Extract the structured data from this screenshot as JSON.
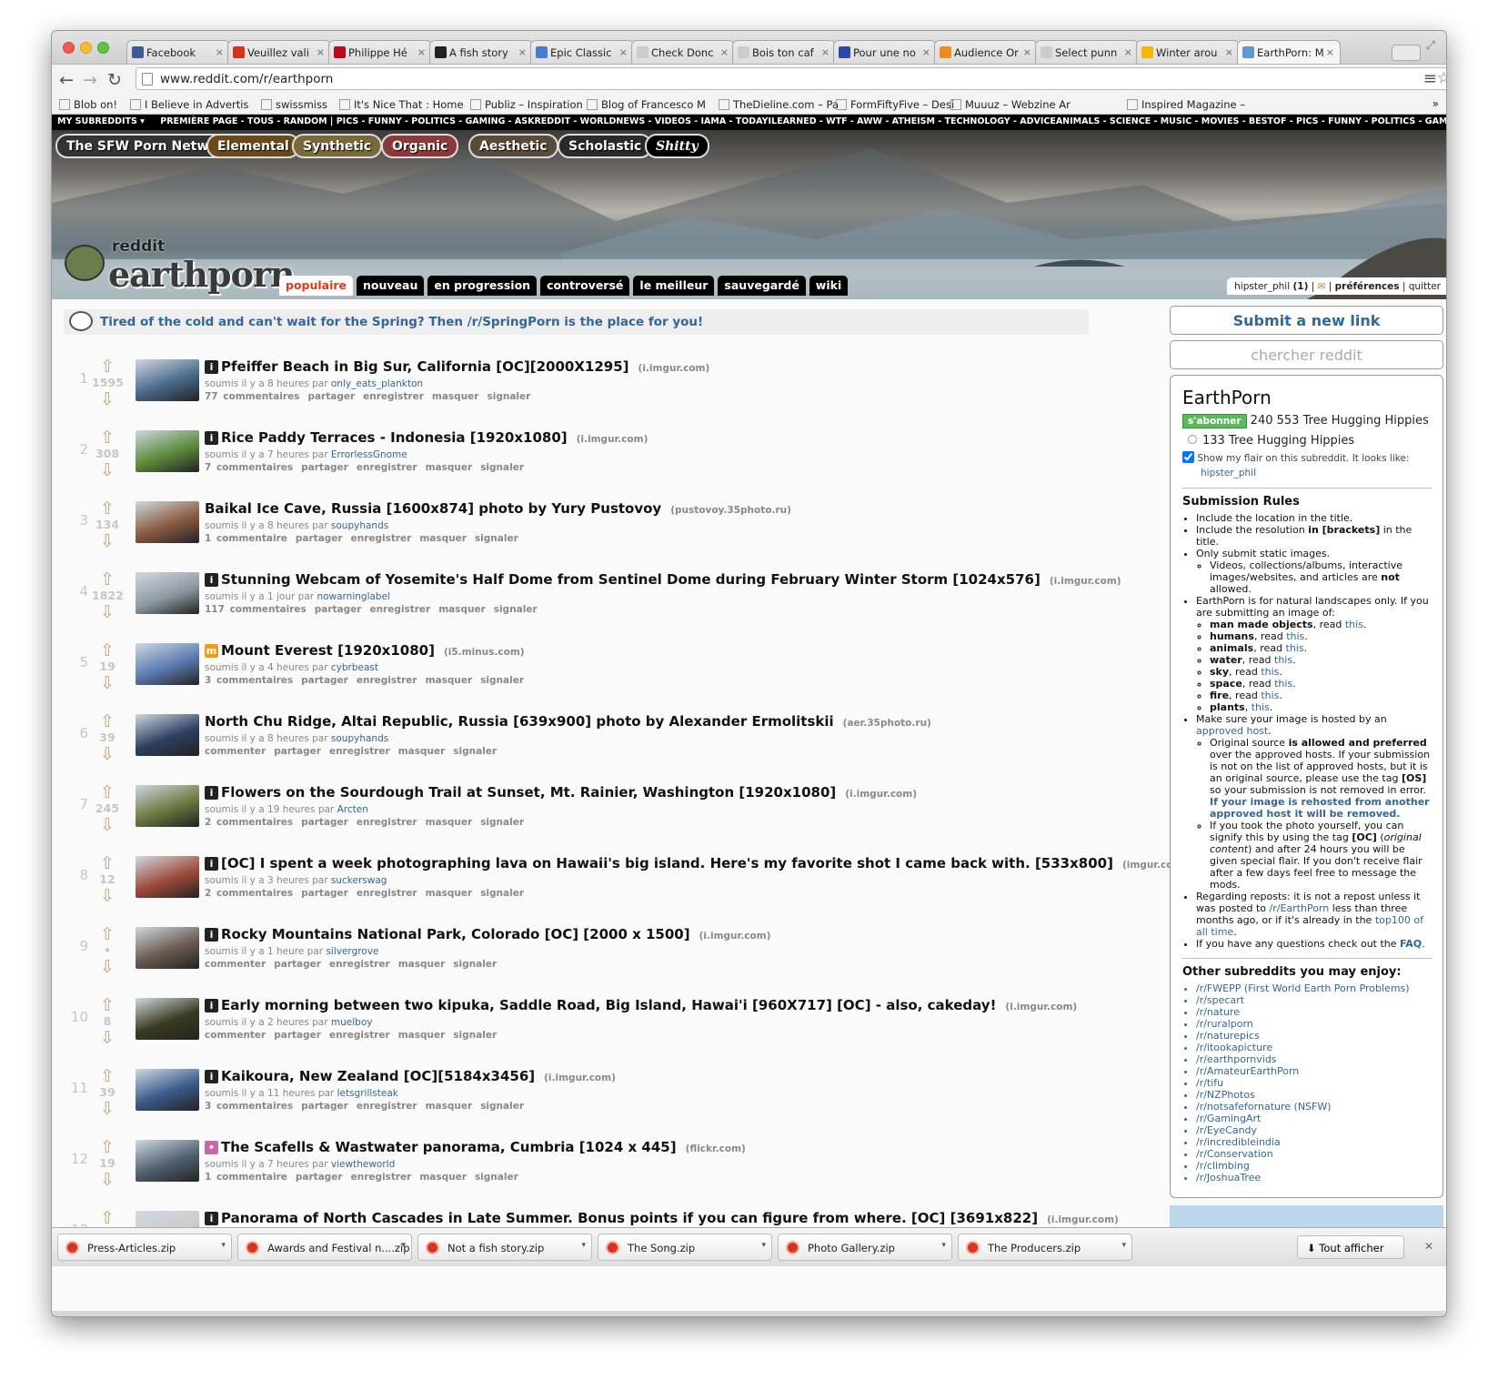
{
  "browser": {
    "tabs": [
      {
        "label": "Facebook",
        "color": "#3b5998"
      },
      {
        "label": "Veuillez vali",
        "color": "#d93025"
      },
      {
        "label": "Philippe Hé",
        "color": "#bd081c"
      },
      {
        "label": "A fish story",
        "color": "#222222"
      },
      {
        "label": "Epic Classic",
        "color": "#4a7bd3"
      },
      {
        "label": "Check Donc",
        "color": "#cccccc"
      },
      {
        "label": "Bois ton caf",
        "color": "#cccccc"
      },
      {
        "label": "Pour une no",
        "color": "#2a4aa8"
      },
      {
        "label": "Audience Or",
        "color": "#f08a24"
      },
      {
        "label": "Select punn",
        "color": "#cccccc"
      },
      {
        "label": "Winter arou",
        "color": "#f5b800"
      },
      {
        "label": "EarthPorn: M",
        "color": "#5f99cf"
      }
    ],
    "url": "www.reddit.com/r/earthporn",
    "bookmarks": [
      {
        "label": "Blob on!"
      },
      {
        "label": "I Believe in Advertis"
      },
      {
        "label": "swissmiss"
      },
      {
        "label": "It's Nice That : Home"
      },
      {
        "label": "Publiz – Inspiration"
      },
      {
        "label": "Blog of Francesco M"
      },
      {
        "label": "TheDieline.com – Pa"
      },
      {
        "label": "FormFiftyFive – Desi"
      },
      {
        "label": "Muuuz – Webzine Ar"
      },
      {
        "label": "Inspired Magazine –"
      }
    ]
  },
  "reddit": {
    "my_subreddits": "MY SUBREDDITS",
    "srbar": "PREMIÈRE PAGE - TOUS - RANDOM  |  PICS - FUNNY - POLITICS - GAMING - ASKREDDIT - WORLDNEWS - VIDEOS - IAMA - TODAYILEARNED - WTF - AWW - ATHEISM - TECHNOLOGY - ADVICEANIMALS - SCIENCE - MUSIC - MOVIES - BESTOF  -  PICS - FUNNY - POLITICS - GAMING - ASKREDDIT - WORLDNEWS",
    "network": [
      "The SFW Porn Network",
      "Elemental",
      "Synthetic",
      "Organic",
      "Aesthetic",
      "Scholastic",
      "Shitty"
    ],
    "logo_top": "reddit",
    "logo_main": "earthporn",
    "sort_tabs": [
      "populaire",
      "nouveau",
      "en progression",
      "controversé",
      "le meilleur",
      "sauvegardé",
      "wiki"
    ],
    "user": "hipster_phil",
    "karma": "(1)",
    "prefs": "préférences",
    "logout": "quitter",
    "announce": "Tired of the cold and can't wait for the Spring? Then /r/SpringPorn is the place for you!",
    "posts": [
      {
        "rank": "1",
        "score": "1595",
        "title": "Pfeiffer Beach in Big Sur, California [OC][2000X1295]",
        "domain": "(i.imgur.com)",
        "time": "soumis il y a 8 heures par",
        "author": "only_eats_plankton",
        "comments": "77 commentaires",
        "thumb": "#4a6a8a"
      },
      {
        "rank": "2",
        "score": "308",
        "title": "Rice Paddy Terraces - Indonesia [1920x1080]",
        "domain": "(i.imgur.com)",
        "time": "soumis il y a 7 heures par",
        "author": "ErrorlessGnome",
        "comments": "7 commentaires",
        "thumb": "#5d8a3c"
      },
      {
        "rank": "3",
        "score": "134",
        "title": "Baikal Ice Cave, Russia [1600x874] photo by Yury Pustovoy",
        "domain": "(pustovoy.35photo.ru)",
        "time": "soumis il y a 8 heures par",
        "author": "soupyhands",
        "comments": "1 commentaire",
        "thumb": "#8a5a40"
      },
      {
        "rank": "4",
        "score": "1822",
        "title": "Stunning Webcam of Yosemite's Half Dome from Sentinel Dome during February Winter Storm [1024x576]",
        "domain": "(i.imgur.com)",
        "time": "soumis il y a 1 jour par",
        "author": "nowarninglabel",
        "comments": "117 commentaires",
        "thumb": "#8e9aa2"
      },
      {
        "rank": "5",
        "score": "19",
        "title": "Mount Everest [1920x1080]",
        "domain": "(i5.minus.com)",
        "time": "soumis il y a 4 heures par",
        "author": "cybrbeast",
        "comments": "3 commentaires",
        "thumb": "#5a7ab0"
      },
      {
        "rank": "6",
        "score": "39",
        "title": "North Chu Ridge, Altai Republic, Russia [639x900] photo by Alexander Ermolitskii",
        "domain": "(aer.35photo.ru)",
        "time": "soumis il y a 8 heures par",
        "author": "soupyhands",
        "comments": "commenter",
        "thumb": "#2f3f60"
      },
      {
        "rank": "7",
        "score": "245",
        "title": "Flowers on the Sourdough Trail at Sunset, Mt. Rainier, Washington [1920x1080]",
        "domain": "(i.imgur.com)",
        "time": "soumis il y a 19 heures par",
        "author": "Arcten",
        "comments": "2 commentaires",
        "thumb": "#6a7a40"
      },
      {
        "rank": "8",
        "score": "12",
        "title": "[OC] I spent a week photographing lava on Hawaii's big island. Here's my favorite shot I came back with. [533x800]",
        "domain": "(imgur.com)",
        "time": "soumis il y a 3 heures par",
        "author": "suckerswag",
        "comments": "2 commentaires",
        "thumb": "#a04a3a"
      },
      {
        "rank": "9",
        "score": "•",
        "title": "Rocky Mountains National Park, Colorado [OC] [2000 x 1500]",
        "domain": "(i.imgur.com)",
        "time": "soumis il y a 1 heure par",
        "author": "silvergrove",
        "comments": "commenter",
        "thumb": "#6a5a50"
      },
      {
        "rank": "10",
        "score": "8",
        "title": "Early morning between two kipuka, Saddle Road, Big Island, Hawai'i [960X717] [OC] - also, cakeday!",
        "domain": "(i.imgur.com)",
        "time": "soumis il y a 2 heures par",
        "author": "muelboy",
        "comments": "commenter",
        "thumb": "#3a3a20"
      },
      {
        "rank": "11",
        "score": "39",
        "title": "Kaikoura, New Zealand [OC][5184x3456]",
        "domain": "(i.imgur.com)",
        "time": "soumis il y a 11 heures par",
        "author": "letsgrillsteak",
        "comments": "3 commentaires",
        "thumb": "#3a5a8a"
      },
      {
        "rank": "12",
        "score": "19",
        "title": "The Scafells & Wastwater panorama, Cumbria [1024 x 445]",
        "domain": "(flickr.com)",
        "time": "soumis il y a 7 heures par",
        "author": "viewtheworld",
        "comments": "1 commentaire",
        "thumb": "#506070"
      },
      {
        "rank": "13",
        "score": "",
        "title": "Panorama of North Cascades in Late Summer. Bonus points if you can figure from where. [OC] [3691x822]",
        "domain": "(i.imgur.com)",
        "time": "",
        "author": "",
        "comments": "",
        "thumb": "#cccccc"
      }
    ],
    "post_buttons": [
      "partager",
      "enregistrer",
      "masquer",
      "signaler"
    ],
    "sidebar": {
      "submit": "Submit a new link",
      "search": "chercher reddit",
      "name": "EarthPorn",
      "subscribe": "s'abonner",
      "subscribers": "240 553 Tree Hugging Hippies",
      "online": "133 Tree Hugging Hippies",
      "flair_note": "Show my flair on this subreddit. It looks like:",
      "flair_user": "hipster_phil",
      "rules_title": "Submission Rules",
      "other_title": "Other subreddits you may enjoy:",
      "others": [
        "/r/FWEPP (First World Earth Porn Problems)",
        "/r/specart",
        "/r/nature",
        "/r/ruralporn",
        "/r/naturepics",
        "/r/itookapicture",
        "/r/earthpornvids",
        "/r/AmateurEarthPorn",
        "/r/tifu",
        "/r/NZPhotos",
        "/r/notsafefornature (NSFW)",
        "/r/GamingArt",
        "/r/EyeCandy",
        "/r/incredibleindia",
        "/r/Conservation",
        "/r/climbing",
        "/r/JoshuaTree"
      ]
    }
  },
  "downloads": {
    "items": [
      "Press-Articles.zip",
      "Awards and Festival n....zip",
      "Not a fish story.zip",
      "The Song.zip",
      "Photo Gallery.zip",
      "The Producers.zip"
    ],
    "show_all": "Tout afficher"
  }
}
